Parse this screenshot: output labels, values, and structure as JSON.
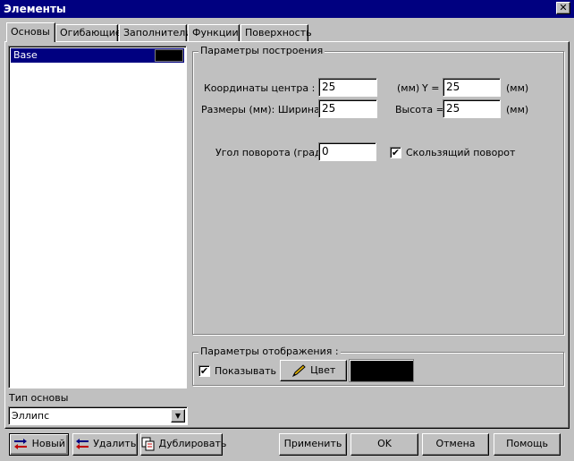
{
  "window": {
    "title": "Элементы",
    "close_glyph": "✕"
  },
  "tabs": [
    {
      "label": "Основы",
      "active": true
    },
    {
      "label": "Огибающие",
      "active": false
    },
    {
      "label": "Заполнители",
      "active": false
    },
    {
      "label": "Функции",
      "active": false
    },
    {
      "label": "Поверхность",
      "active": false
    }
  ],
  "element_list": {
    "items": [
      {
        "label": "Base",
        "selected": true,
        "color": "#000000"
      }
    ]
  },
  "base_type": {
    "label": "Тип основы",
    "selected": "Эллипс",
    "arrow_glyph": "▼"
  },
  "build_params": {
    "legend": "Параметры построения",
    "center_label": "Координаты центра : X =",
    "center_x": "25",
    "units_mm_paren": "(мм)",
    "y_label": "Y =",
    "center_y": "25",
    "size_label": "Размеры  (мм): Ширина =",
    "width": "25",
    "height_label": "Высота =",
    "height": "25",
    "units_mm": "(мм)",
    "angle_label": "Угол поворота (град) :",
    "angle": "0",
    "sliding_rotation_label": "Скользящий поворот",
    "sliding_rotation_checked": true
  },
  "display_params": {
    "legend": "Параметры отображения :",
    "show_label": "Показывать",
    "show_checked": true,
    "color_button_label": "Цвет",
    "color": "#000000"
  },
  "bottom_buttons": {
    "new": "Новый",
    "delete": "Удалить",
    "duplicate": "Дублировать",
    "apply": "Применить",
    "ok": "OK",
    "cancel": "Отмена",
    "help": "Помощь"
  },
  "icons": {
    "new": "new-element-icon",
    "delete": "delete-element-icon",
    "duplicate": "duplicate-icon",
    "color": "pencil-icon"
  },
  "check_glyph": "✔"
}
